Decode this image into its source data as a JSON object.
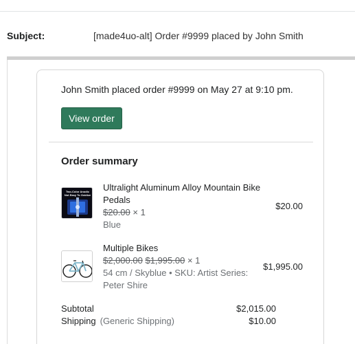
{
  "email": {
    "subject_label": "Subject:",
    "subject": "[made4uo-alt] Order #9999 placed by John Smith"
  },
  "card": {
    "intro": "John Smith placed order #9999 on May 27 at 9:10 pm.",
    "view_order_label": "View order",
    "summary_title": "Order summary",
    "items": [
      {
        "title": "Ultralight Aluminum Alloy Mountain Bike Pedals",
        "original_price": "$20.00",
        "quantity": "× 1",
        "variant": "Blue",
        "price": "$20.00",
        "thumb_icon": "pedals-product-image",
        "thumb_text": "Two-Color Anodic\nNot Easy To Oxidize"
      },
      {
        "title": "Multiple Bikes",
        "original_price": "$2,000.00",
        "sale_price": "$1,995.00",
        "quantity": "× 1",
        "variant": "54 cm / Skyblue • SKU: Artist Series: Peter Shire",
        "price": "$1,995.00",
        "thumb_icon": "bicycle-product-image"
      }
    ],
    "totals": {
      "subtotal_label": "Subtotal",
      "subtotal_value": "$2,015.00",
      "shipping_label": "Shipping",
      "shipping_method": "(Generic Shipping)",
      "shipping_value": "$10.00"
    }
  },
  "colors": {
    "button": "#2f7a5b",
    "button_text": "#ffffff"
  }
}
